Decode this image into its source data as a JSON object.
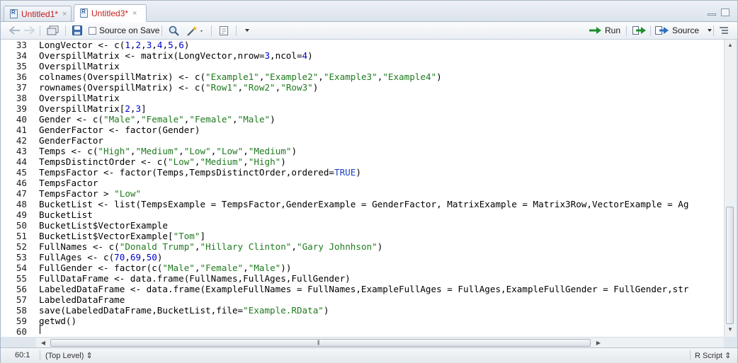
{
  "tabs": [
    {
      "label": "Untitled1*",
      "close": "×"
    },
    {
      "label": "Untitled3*",
      "close": "×"
    }
  ],
  "toolbar": {
    "source_on_save_label": "Source on Save",
    "run_label": "Run",
    "source_label": "Source"
  },
  "editor": {
    "lines": [
      {
        "n": "33",
        "code": "LongVector <- c(1,2,3,4,5,6)"
      },
      {
        "n": "34",
        "code": "OverspillMatrix <- matrix(LongVector,nrow=3,ncol=4)"
      },
      {
        "n": "35",
        "code": "OverspillMatrix"
      },
      {
        "n": "36",
        "code": "colnames(OverspillMatrix) <- c(\"Example1\",\"Example2\",\"Example3\",\"Example4\")"
      },
      {
        "n": "37",
        "code": "rownames(OverspillMatrix) <- c(\"Row1\",\"Row2\",\"Row3\")"
      },
      {
        "n": "38",
        "code": "OverspillMatrix"
      },
      {
        "n": "39",
        "code": "OverspillMatrix[2,3]"
      },
      {
        "n": "40",
        "code": "Gender <- c(\"Male\",\"Female\",\"Female\",\"Male\")"
      },
      {
        "n": "41",
        "code": "GenderFactor <- factor(Gender)"
      },
      {
        "n": "42",
        "code": "GenderFactor"
      },
      {
        "n": "43",
        "code": "Temps <- c(\"High\",\"Medium\",\"Low\",\"Low\",\"Medium\")"
      },
      {
        "n": "44",
        "code": "TempsDistinctOrder <- c(\"Low\",\"Medium\",\"High\")"
      },
      {
        "n": "45",
        "code": "TempsFactor <- factor(Temps,TempsDistinctOrder,ordered=TRUE)"
      },
      {
        "n": "46",
        "code": "TempsFactor"
      },
      {
        "n": "47",
        "code": "TempsFactor > \"Low\""
      },
      {
        "n": "48",
        "code": "BucketList <- list(TempsExample = TempsFactor,GenderExample = GenderFactor, MatrixExample = Matrix3Row,VectorExample = Ag"
      },
      {
        "n": "49",
        "code": "BucketList"
      },
      {
        "n": "50",
        "code": "BucketList$VectorExample"
      },
      {
        "n": "51",
        "code": "BucketList$VectorExample[\"Tom\"]"
      },
      {
        "n": "52",
        "code": "FullNames <- c(\"Donald Trump\",\"Hillary Clinton\",\"Gary Johnhson\")"
      },
      {
        "n": "53",
        "code": "FullAges <- c(70,69,50)"
      },
      {
        "n": "54",
        "code": "FullGender <- factor(c(\"Male\",\"Female\",\"Male\"))"
      },
      {
        "n": "55",
        "code": "FullDataFrame <- data.frame(FullNames,FullAges,FullGender)"
      },
      {
        "n": "56",
        "code": "LabeledDataFrame <- data.frame(ExampleFullNames = FullNames,ExampleFullAges = FullAges,ExampleFullGender = FullGender,str"
      },
      {
        "n": "57",
        "code": "LabeledDataFrame"
      },
      {
        "n": "58",
        "code": "save(LabeledDataFrame,BucketList,file=\"Example.RData\")"
      },
      {
        "n": "59",
        "code": "getwd()"
      },
      {
        "n": "60",
        "code": ""
      }
    ]
  },
  "statusbar": {
    "position": "60:1",
    "scope": "(Top Level) ⇕",
    "filetype": "R Script ⇕"
  },
  "colors": {
    "string": "#1f7a1f",
    "number": "#0000cc",
    "keyword": "#1c3fbf",
    "tab_modified": "#c41e1e"
  }
}
